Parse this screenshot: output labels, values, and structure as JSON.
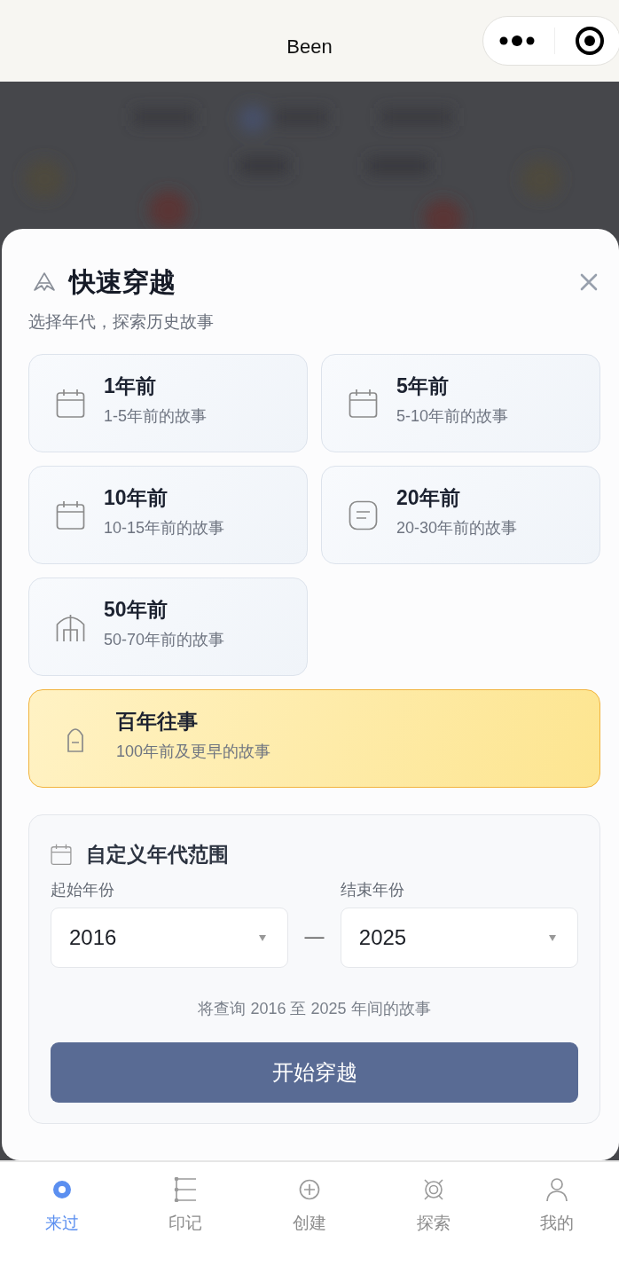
{
  "top_bar": {
    "title": "Been"
  },
  "sheet": {
    "title": "快速穿越",
    "subtitle": "选择年代，探索历史故事",
    "periods": [
      {
        "kind": "normal",
        "title": "1年前",
        "description": "1-5年前的故事"
      },
      {
        "kind": "normal",
        "title": "5年前",
        "description": "5-10年前的故事"
      },
      {
        "kind": "normal",
        "title": "10年前",
        "description": "10-15年前的故事"
      },
      {
        "kind": "normal",
        "title": "20年前",
        "description": "20-30年前的故事"
      },
      {
        "kind": "normal",
        "title": "50年前",
        "description": "50-70年前的故事"
      },
      {
        "kind": "featured",
        "title": "百年往事",
        "description": "100年前及更早的故事"
      }
    ],
    "custom_range": {
      "title": "自定义年代范围",
      "start": {
        "label": "起始年份",
        "value": "2016"
      },
      "separator": "—",
      "end": {
        "label": "结束年份",
        "value": "2025"
      },
      "hint": "将查询 2016 至 2025 年间的故事",
      "button": "开始穿越"
    }
  },
  "tab_bar": [
    {
      "label": "来过",
      "selected": true
    },
    {
      "label": "印记",
      "selected": false
    },
    {
      "label": "创建",
      "selected": false
    },
    {
      "label": "探索",
      "selected": false
    },
    {
      "label": "我的",
      "selected": false
    }
  ]
}
